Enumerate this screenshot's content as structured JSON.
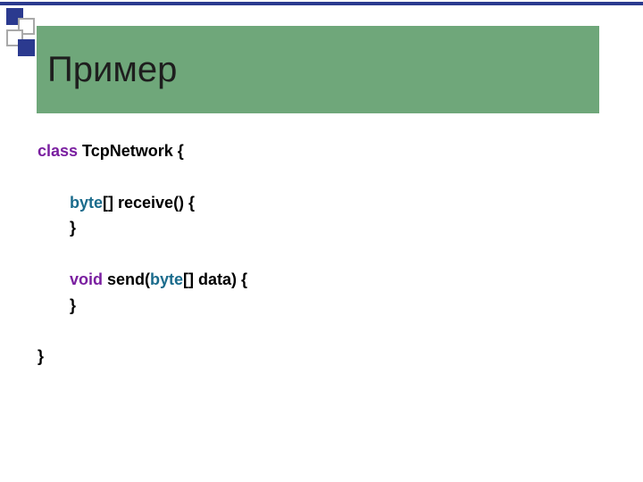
{
  "slide": {
    "title": "Пример"
  },
  "code": {
    "kw_class": "class",
    "class_name": " TcpNetwork {",
    "kw_byte_1": "byte",
    "after_byte_1": "[] receive() {",
    "close_brace_1": "}",
    "kw_void": "void",
    "send_prefix": " send(",
    "kw_byte_2": "byte",
    "after_byte_2": "[] data) {",
    "close_brace_2": "}",
    "close_brace_class": "}"
  },
  "colors": {
    "accent": "#2b3a8f",
    "title_band": "#6fa77a"
  }
}
